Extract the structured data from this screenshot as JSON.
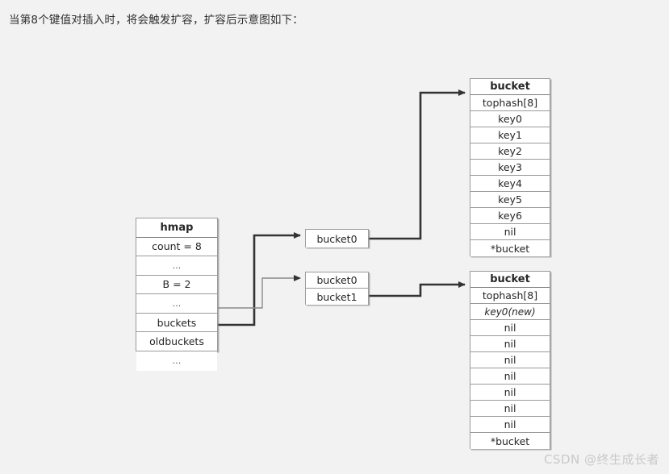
{
  "caption": "当第8个键值对插入时，将会触发扩容，扩容后示意图如下：",
  "colors": {
    "background": "#f2f2f2",
    "box_fill": "#ffffff",
    "box_border": "#9a9a9a",
    "wire_dark": "#333333",
    "wire_light": "#8a8a8a",
    "text": "#262626",
    "watermark": "#c9c9c9"
  },
  "hmap": {
    "title": "hmap",
    "rows": [
      {
        "label": "hmap",
        "style": "head"
      },
      {
        "label": "count = 8",
        "style": "plain"
      },
      {
        "label": "...",
        "style": "dots"
      },
      {
        "label": "B = 2",
        "style": "plain"
      },
      {
        "label": "...",
        "style": "dots"
      },
      {
        "label": "buckets",
        "style": "plain"
      },
      {
        "label": "oldbuckets",
        "style": "plain"
      },
      {
        "label": "...",
        "style": "dots"
      }
    ]
  },
  "oldbuckets_array": {
    "rows": [
      {
        "label": "bucket0",
        "style": "plain"
      }
    ]
  },
  "buckets_array": {
    "rows": [
      {
        "label": "bucket0",
        "style": "plain"
      },
      {
        "label": "bucket1",
        "style": "plain"
      }
    ]
  },
  "bucket_old": {
    "title": "bucket",
    "rows": [
      {
        "label": "bucket",
        "style": "head"
      },
      {
        "label": "tophash[8]",
        "style": "plain"
      },
      {
        "label": "key0",
        "style": "plain"
      },
      {
        "label": "key1",
        "style": "plain"
      },
      {
        "label": "key2",
        "style": "plain"
      },
      {
        "label": "key3",
        "style": "plain"
      },
      {
        "label": "key4",
        "style": "plain"
      },
      {
        "label": "key5",
        "style": "plain"
      },
      {
        "label": "key6",
        "style": "plain"
      },
      {
        "label": "nil",
        "style": "plain"
      },
      {
        "label": "*bucket",
        "style": "plain"
      }
    ]
  },
  "bucket_new": {
    "title": "bucket",
    "rows": [
      {
        "label": "bucket",
        "style": "head"
      },
      {
        "label": "tophash[8]",
        "style": "plain"
      },
      {
        "label": "key0(new)",
        "style": "ital"
      },
      {
        "label": "nil",
        "style": "plain"
      },
      {
        "label": "nil",
        "style": "plain"
      },
      {
        "label": "nil",
        "style": "plain"
      },
      {
        "label": "nil",
        "style": "plain"
      },
      {
        "label": "nil",
        "style": "plain"
      },
      {
        "label": "nil",
        "style": "plain"
      },
      {
        "label": "nil",
        "style": "plain"
      },
      {
        "label": "*bucket",
        "style": "plain"
      }
    ]
  },
  "watermark": "CSDN @终生成长者"
}
